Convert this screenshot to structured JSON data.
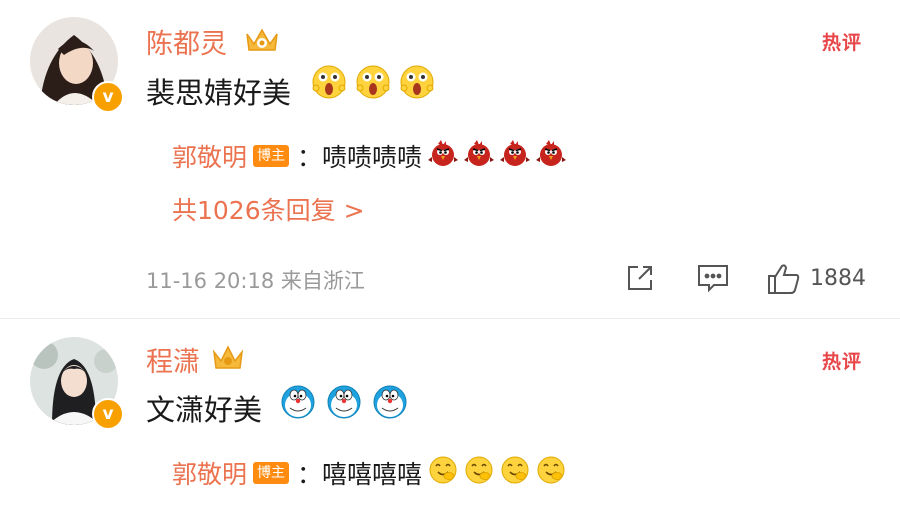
{
  "comments": [
    {
      "username": "陈都灵",
      "hot_label": "热评",
      "verified_mark": "v",
      "text": "裴思婧好美",
      "emoji_icons": [
        "surprised-face-emoji",
        "surprised-face-emoji",
        "surprised-face-emoji"
      ],
      "reply": {
        "name": "郭敬明",
        "badge": "博主",
        "colon": "：",
        "text": "啧啧啧啧",
        "emoji_icons": [
          "angry-bird-emoji",
          "angry-bird-emoji",
          "angry-bird-emoji",
          "angry-bird-emoji"
        ]
      },
      "total_replies": "共1026条回复 >",
      "timestamp": "11-16 20:18",
      "location": "来自浙江",
      "like_count": "1884"
    },
    {
      "username": "程潇",
      "hot_label": "热评",
      "verified_mark": "v",
      "text": "文潇好美",
      "emoji_icons": [
        "doraemon-emoji",
        "doraemon-emoji",
        "doraemon-emoji"
      ],
      "reply": {
        "name": "郭敬明",
        "badge": "博主",
        "colon": "：",
        "text": "嘻嘻嘻嘻",
        "emoji_icons": [
          "giggle-face-emoji",
          "giggle-face-emoji",
          "giggle-face-emoji",
          "giggle-face-emoji"
        ]
      }
    }
  ],
  "colors": {
    "username": "#eb7350",
    "hot_label": "#e8474a",
    "blogger_badge": "#ff8c10",
    "verified_badge": "#f7a000",
    "meta_text": "#9a9a9a"
  }
}
